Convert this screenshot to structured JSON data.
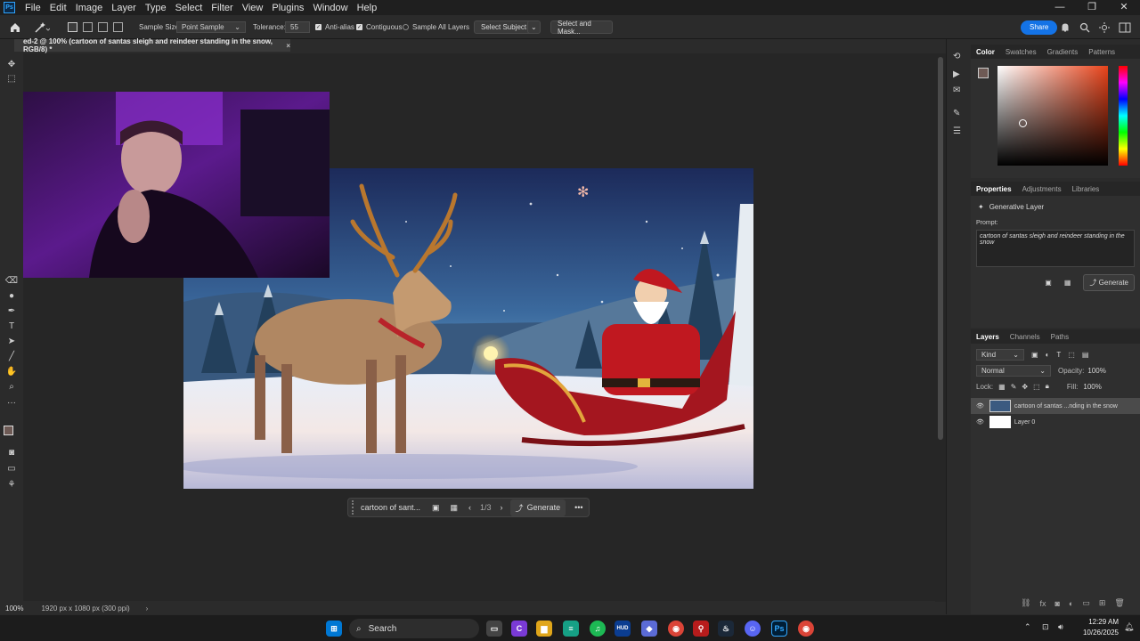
{
  "app": {
    "menu": [
      "File",
      "Edit",
      "Image",
      "Layer",
      "Type",
      "Select",
      "Filter",
      "View",
      "Plugins",
      "Window",
      "Help"
    ],
    "window_controls": [
      "—",
      "❐",
      "✕"
    ]
  },
  "options": {
    "sample_size_label": "Sample Size:",
    "sample_size_value": "Point Sample",
    "tolerance_label": "Tolerance:",
    "tolerance_value": "55",
    "anti_alias": "Anti-alias",
    "contiguous": "Contiguous",
    "sample_all_layers": "Sample All Layers",
    "select_subject": "Select Subject",
    "select_and_mask": "Select and Mask...",
    "share": "Share"
  },
  "document": {
    "tab_title": "ed-2 @ 100% (cartoon of santas sleigh and reindeer standing in the snow, RGB/8) *",
    "zoom": "100%",
    "doc_info": "1920 px x 1080 px (300 ppi)"
  },
  "context_bar": {
    "prompt_short": "cartoon of sant...",
    "page": "1/3",
    "generate": "Generate"
  },
  "color_panel": {
    "tabs": [
      "Color",
      "Swatches",
      "Gradients",
      "Patterns"
    ],
    "fg_color": "#6e5a55",
    "hue_base": "#e8431a"
  },
  "properties_panel": {
    "tabs": [
      "Properties",
      "Adjustments",
      "Libraries"
    ],
    "layer_type": "Generative Layer",
    "prompt_label": "Prompt:",
    "prompt_text": "cartoon of santas sleigh and reindeer standing in the snow",
    "generate": "Generate"
  },
  "layers_panel": {
    "tabs": [
      "Layers",
      "Channels",
      "Paths"
    ],
    "kind": "Kind",
    "blend_mode": "Normal",
    "opacity_label": "Opacity:",
    "opacity_value": "100%",
    "lock_label": "Lock:",
    "fill_label": "Fill:",
    "fill_value": "100%",
    "layers": [
      {
        "name": "cartoon of santas ...nding in the snow",
        "selected": true
      },
      {
        "name": "Layer 0",
        "selected": false
      }
    ]
  },
  "taskbar": {
    "search": "Search",
    "time": "12:29 AM",
    "date": "10/26/2025"
  }
}
